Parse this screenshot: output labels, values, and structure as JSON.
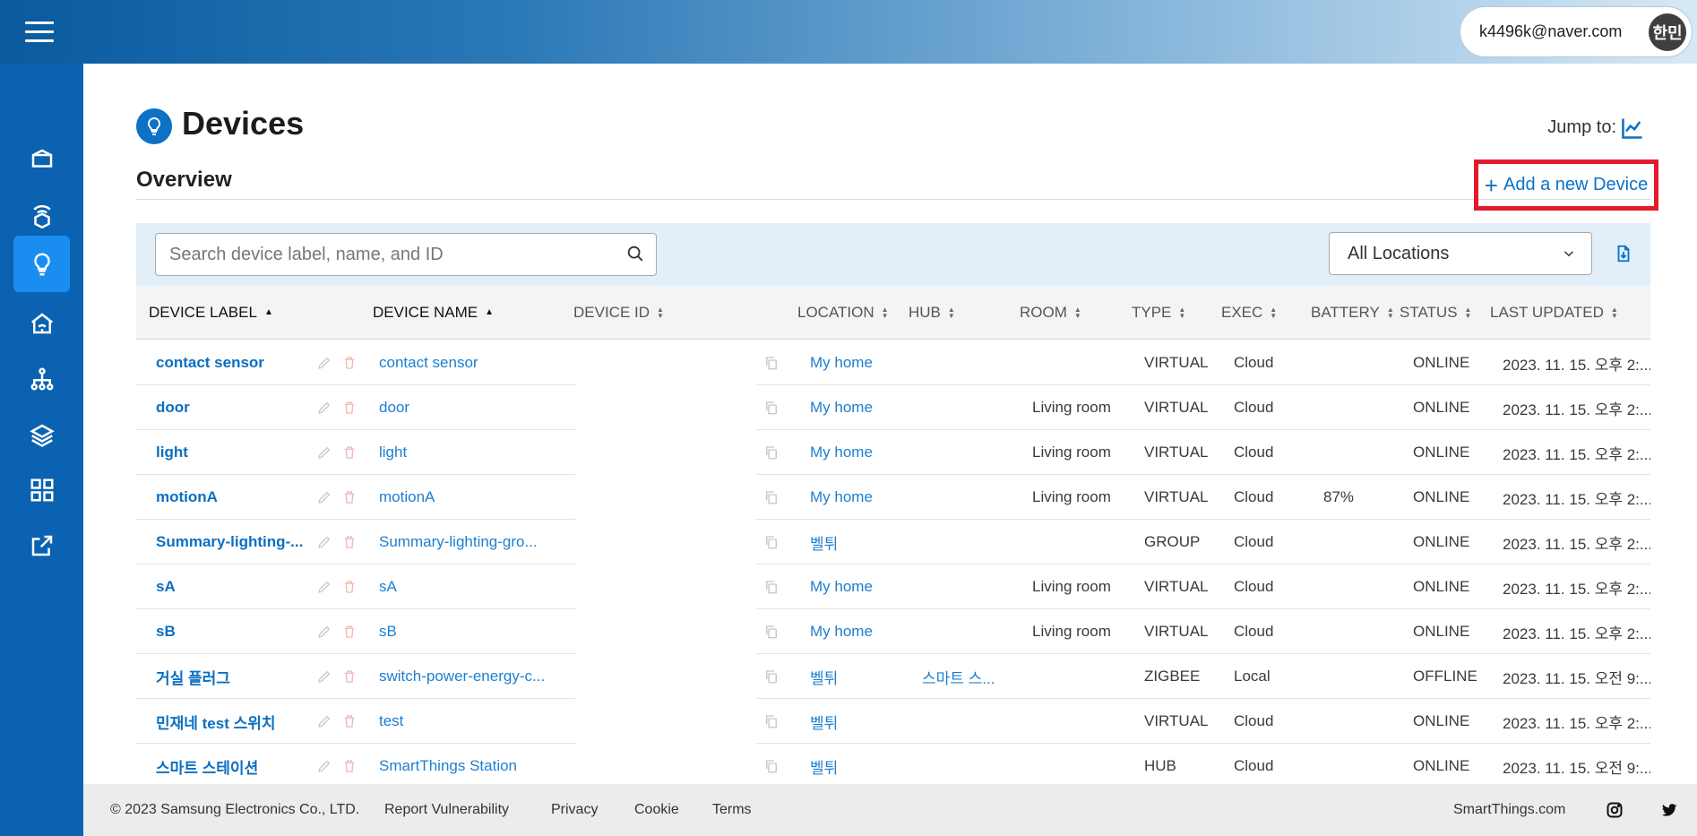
{
  "header": {
    "user_email": "k4496k@naver.com",
    "avatar_text": "한민"
  },
  "sidebar": {
    "items": [
      {
        "name": "sidebar-item-projects",
        "icon": "box-icon",
        "active": false
      },
      {
        "name": "sidebar-item-hubs",
        "icon": "wireless-hub-icon",
        "active": false
      },
      {
        "name": "sidebar-item-devices",
        "icon": "lightbulb-icon",
        "active": true
      },
      {
        "name": "sidebar-item-locations",
        "icon": "home-wifi-icon",
        "active": false
      },
      {
        "name": "sidebar-item-network",
        "icon": "network-icon",
        "active": false
      },
      {
        "name": "sidebar-item-layers",
        "icon": "layers-icon",
        "active": false
      },
      {
        "name": "sidebar-item-dashboard",
        "icon": "grid-icon",
        "active": false
      },
      {
        "name": "sidebar-item-external",
        "icon": "external-link-icon",
        "active": false
      }
    ]
  },
  "page": {
    "title": "Devices",
    "jump_to": "Jump to:",
    "overview": "Overview",
    "add_device": "Add a new Device"
  },
  "filters": {
    "search_placeholder": "Search device label, name, and ID",
    "location_selected": "All Locations"
  },
  "table": {
    "columns": [
      "DEVICE LABEL",
      "DEVICE NAME",
      "DEVICE ID",
      "LOCATION",
      "HUB",
      "ROOM",
      "TYPE",
      "EXEC",
      "BATTERY",
      "STATUS",
      "LAST UPDATED"
    ],
    "rows": [
      {
        "label": "contact sensor",
        "name": "contact sensor",
        "location": "My home",
        "hub": "",
        "room": "",
        "type": "VIRTUAL",
        "exec": "Cloud",
        "battery": "",
        "status": "ONLINE",
        "updated": "2023. 11. 15. 오후 2:..."
      },
      {
        "label": "door",
        "name": "door",
        "location": "My home",
        "hub": "",
        "room": "Living room",
        "type": "VIRTUAL",
        "exec": "Cloud",
        "battery": "",
        "status": "ONLINE",
        "updated": "2023. 11. 15. 오후 2:..."
      },
      {
        "label": "light",
        "name": "light",
        "location": "My home",
        "hub": "",
        "room": "Living room",
        "type": "VIRTUAL",
        "exec": "Cloud",
        "battery": "",
        "status": "ONLINE",
        "updated": "2023. 11. 15. 오후 2:..."
      },
      {
        "label": "motionA",
        "name": "motionA",
        "location": "My home",
        "hub": "",
        "room": "Living room",
        "type": "VIRTUAL",
        "exec": "Cloud",
        "battery": "87%",
        "status": "ONLINE",
        "updated": "2023. 11. 15. 오후 2:..."
      },
      {
        "label": "Summary-lighting-...",
        "name": "Summary-lighting-gro...",
        "location": "벨튀",
        "hub": "",
        "room": "",
        "type": "GROUP",
        "exec": "Cloud",
        "battery": "",
        "status": "ONLINE",
        "updated": "2023. 11. 15. 오후 2:..."
      },
      {
        "label": "sA",
        "name": "sA",
        "location": "My home",
        "hub": "",
        "room": "Living room",
        "type": "VIRTUAL",
        "exec": "Cloud",
        "battery": "",
        "status": "ONLINE",
        "updated": "2023. 11. 15. 오후 2:..."
      },
      {
        "label": "sB",
        "name": "sB",
        "location": "My home",
        "hub": "",
        "room": "Living room",
        "type": "VIRTUAL",
        "exec": "Cloud",
        "battery": "",
        "status": "ONLINE",
        "updated": "2023. 11. 15. 오후 2:..."
      },
      {
        "label": "거실 플러그",
        "name": "switch-power-energy-c...",
        "location": "벨튀",
        "hub": "스마트 스...",
        "room": "",
        "type": "ZIGBEE",
        "exec": "Local",
        "battery": "",
        "status": "OFFLINE",
        "updated": "2023. 11. 15. 오전 9:..."
      },
      {
        "label": "민재네 test 스위치",
        "name": "test",
        "location": "벨튀",
        "hub": "",
        "room": "",
        "type": "VIRTUAL",
        "exec": "Cloud",
        "battery": "",
        "status": "ONLINE",
        "updated": "2023. 11. 15. 오후 2:..."
      },
      {
        "label": "스마트 스테이션",
        "name": "SmartThings Station",
        "location": "벨튀",
        "hub": "",
        "room": "",
        "type": "HUB",
        "exec": "Cloud",
        "battery": "",
        "status": "ONLINE",
        "updated": "2023. 11. 15. 오전 9:..."
      }
    ]
  },
  "footer": {
    "copyright": "© 2023 Samsung Electronics Co., LTD.",
    "links": [
      "Report Vulnerability",
      "Privacy",
      "Cookie",
      "Terms"
    ],
    "site": "SmartThings.com"
  }
}
